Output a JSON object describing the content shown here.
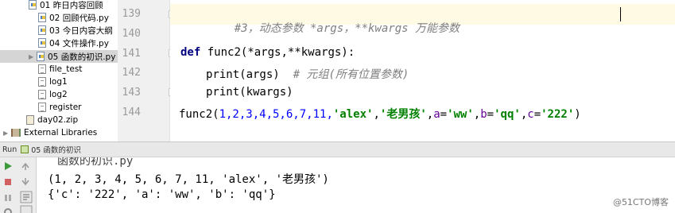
{
  "project_tree": {
    "items": [
      {
        "label": "01 昨日内容回顾",
        "icon": "python-file-icon",
        "top": 0
      },
      {
        "label": "02 回顾代码.py",
        "icon": "python-file-icon"
      },
      {
        "label": "03 今日内容大纲",
        "icon": "python-file-icon"
      },
      {
        "label": "04 文件操作.py",
        "icon": "python-file-icon"
      },
      {
        "label": "05 函数的初识.py",
        "icon": "python-file-icon",
        "selected": true
      },
      {
        "label": "file_test",
        "icon": "text-file-icon"
      },
      {
        "label": "log1",
        "icon": "text-file-icon"
      },
      {
        "label": "log2",
        "icon": "text-file-icon"
      },
      {
        "label": "register",
        "icon": "text-file-icon"
      },
      {
        "label": "day02.zip",
        "icon": "zip-file-icon"
      },
      {
        "label": "External Libraries",
        "icon": "library-icon"
      }
    ]
  },
  "editor": {
    "line_numbers": [
      "139",
      "140",
      "141",
      "142",
      "143",
      "144"
    ],
    "lines": {
      "l139_comment": "#3，动态参数 *args，**kwargs 万能参数",
      "l141_def": "def",
      "l141_sig": " func2(*args,**kwargs):",
      "l142_code": "print(args)  ",
      "l142_comment": "# 元组(所有位置参数)",
      "l143_code": "print(kwargs)",
      "l144_call": "func2(",
      "l144_nums": "1,2,3,4,5,6,7,11,",
      "l144_s1": "'alex'",
      "l144_sep1": ",",
      "l144_s2": "'老男孩'",
      "l144_sep2": ",",
      "l144_k1": "a",
      "l144_eq1": "=",
      "l144_v1": "'ww'",
      "l144_sep3": ",",
      "l144_k2": "b",
      "l144_eq2": "=",
      "l144_v2": "'qq'",
      "l144_sep4": ",",
      "l144_k3": "c",
      "l144_eq3": "=",
      "l144_v3": "'222'",
      "l144_end": ")"
    }
  },
  "run_panel": {
    "title_prefix": "Run",
    "config_name": "05 函数的初识",
    "output": [
      "函数的初识.py",
      "(1, 2, 3, 4, 5, 6, 7, 11, 'alex', '老男孩')",
      "{'c': '222', 'a': 'ww', 'b': 'qq'}"
    ]
  },
  "watermark": "@51CTO博客",
  "colors": {
    "keyword": "#000080",
    "string": "#008000",
    "comment": "#808080",
    "kwarg": "#660099",
    "current_line": "#fffae3",
    "selected_row": "#d5d5d5"
  }
}
